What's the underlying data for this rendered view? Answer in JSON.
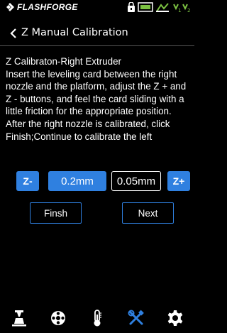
{
  "status_bar": {
    "brand": "FLASHFORGE",
    "icons": [
      "door-lock-icon",
      "filament-icon",
      "wifi-icon",
      "temperature-icons"
    ]
  },
  "header": {
    "title": "Z Manual Calibration",
    "back_icon": "chevron-left-icon"
  },
  "instructions": {
    "text": "Z Calibraton-Right Extruder\nInsert the leveling card between the right nozzle and the platform, adjust the Z + and Z - buttons, and feel the card sliding with a little friction for the appropriate position. After the right nozzle is calibrated, click Finish;Continue to calibrate the left"
  },
  "controls": {
    "z_minus_label": "Z-",
    "step_fine_label": "0.2mm",
    "step_coarse_label": "0.05mm",
    "z_plus_label": "Z+"
  },
  "actions": {
    "finish_label": "Finsh",
    "next_label": "Next"
  },
  "bottom_nav": {
    "items": [
      "print-icon",
      "filament-spool-icon",
      "thermometer-icon",
      "tools-icon",
      "settings-icon"
    ],
    "active": "tools-icon"
  },
  "colors": {
    "accent": "#2f80e0",
    "background": "#000000",
    "text": "#ffffff",
    "status_green": "#7cc242"
  }
}
